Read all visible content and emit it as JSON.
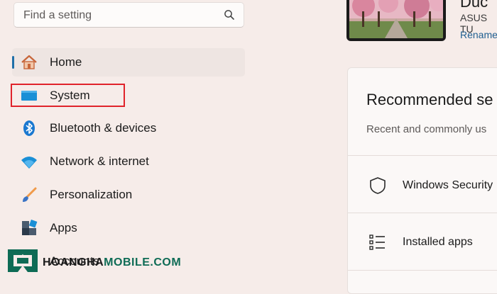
{
  "search": {
    "placeholder": "Find a setting"
  },
  "nav": {
    "items": [
      {
        "label": "Home"
      },
      {
        "label": "System"
      },
      {
        "label": "Bluetooth & devices"
      },
      {
        "label": "Network & internet"
      },
      {
        "label": "Personalization"
      },
      {
        "label": "Apps"
      },
      {
        "label": "Accounts"
      }
    ]
  },
  "device": {
    "name": "Duc",
    "model": "ASUS TU",
    "rename_link": "Rename"
  },
  "recommended": {
    "title": "Recommended se",
    "subtitle": "Recent and commonly us",
    "items": [
      {
        "label": "Windows Security"
      },
      {
        "label": "Installed apps"
      }
    ]
  },
  "watermark": {
    "prefix": "HOANGHA",
    "suffix": "MOBILE.COM"
  },
  "colors": {
    "accent": "#1f6fa8",
    "highlight_border": "#e0232b",
    "watermark": "#0e6b55"
  }
}
